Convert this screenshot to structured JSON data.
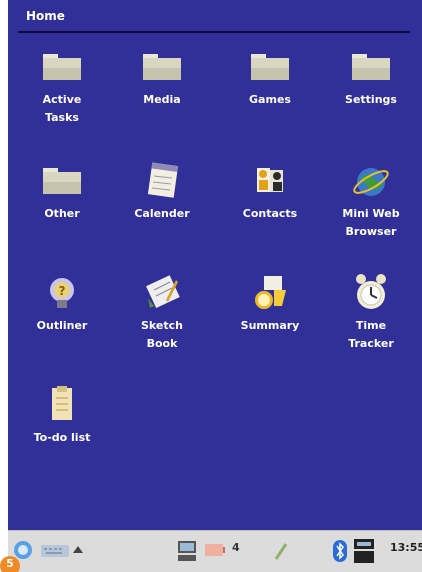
{
  "header": {
    "title": "Home"
  },
  "apps": [
    {
      "label": "Active\nTasks",
      "icon": "folder-icon"
    },
    {
      "label": "Media",
      "icon": "folder-icon"
    },
    {
      "label": "Games",
      "icon": "folder-icon"
    },
    {
      "label": "Settings",
      "icon": "folder-icon"
    },
    {
      "label": "Other",
      "icon": "folder-icon"
    },
    {
      "label": "Calender",
      "icon": "calendar-icon"
    },
    {
      "label": "Contacts",
      "icon": "contacts-icon"
    },
    {
      "label": "Mini Web\nBrowser",
      "icon": "globe-icon"
    },
    {
      "label": "Outliner",
      "icon": "lightbulb-icon"
    },
    {
      "label": "Sketch\nBook",
      "icon": "sketchbook-icon"
    },
    {
      "label": "Summary",
      "icon": "summary-icon"
    },
    {
      "label": "Time\nTracker",
      "icon": "alarm-clock-icon"
    },
    {
      "label": "To-do list",
      "icon": "clipboard-icon"
    }
  ],
  "taskbar": {
    "clock": "13:55",
    "indicator_text": "4"
  },
  "corner_badge": "5",
  "colors": {
    "desktop": "#312f98",
    "taskbar": "#dcdcdc",
    "label": "#ffffff"
  }
}
